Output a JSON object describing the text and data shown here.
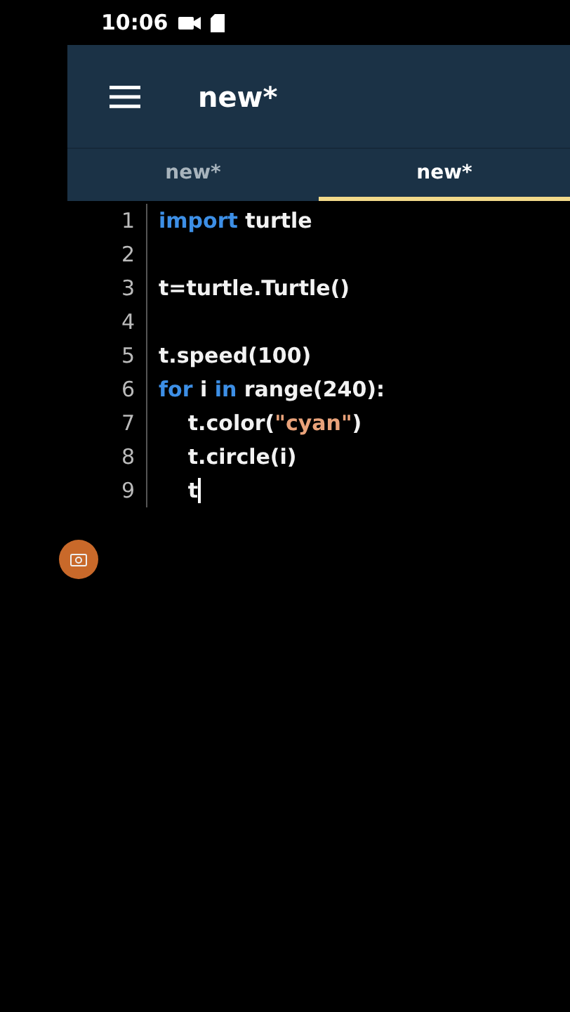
{
  "status_bar": {
    "time": "10:06"
  },
  "toolbar": {
    "title": "new*"
  },
  "tabs": [
    {
      "label": "new*",
      "selected": false
    },
    {
      "label": "new*",
      "selected": true
    }
  ],
  "editor": {
    "lines": [
      {
        "number": "1",
        "cursor": false,
        "tokens": [
          {
            "kind": "keyword",
            "text": "import"
          },
          {
            "kind": "plain",
            "text": " turtle"
          }
        ]
      },
      {
        "number": "2",
        "cursor": false
      },
      {
        "number": "3",
        "cursor": false,
        "tokens": [
          {
            "kind": "plain",
            "text": "t=turtle.Turtle()"
          }
        ]
      },
      {
        "number": "4",
        "cursor": false
      },
      {
        "number": "5",
        "cursor": false,
        "tokens": [
          {
            "kind": "plain",
            "text": "t.speed(100)"
          }
        ]
      },
      {
        "number": "6",
        "cursor": false,
        "tokens": [
          {
            "kind": "keyword",
            "text": "for"
          },
          {
            "kind": "plain",
            "text": " i "
          },
          {
            "kind": "keyword",
            "text": "in"
          },
          {
            "kind": "plain",
            "text": " range(240):"
          }
        ]
      },
      {
        "number": "7",
        "cursor": false,
        "tokens": [
          {
            "kind": "plain",
            "text": "    t.color("
          },
          {
            "kind": "string",
            "text": "\"cyan\""
          },
          {
            "kind": "plain",
            "text": ")"
          }
        ]
      },
      {
        "number": "8",
        "cursor": false,
        "tokens": [
          {
            "kind": "plain",
            "text": "    t.circle(i)"
          }
        ]
      },
      {
        "number": "9",
        "cursor": true,
        "tokens": [
          {
            "kind": "plain",
            "text": "    t"
          }
        ]
      }
    ]
  }
}
